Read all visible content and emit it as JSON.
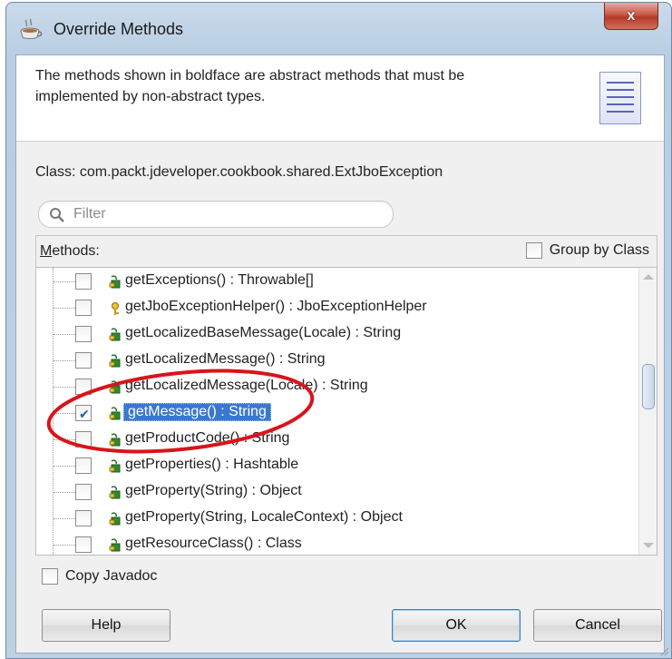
{
  "window": {
    "title": "Override Methods",
    "close_label": "x"
  },
  "header": {
    "description": "The methods shown in boldface are abstract methods that must be implemented by non-abstract types.",
    "icon": "document-icon"
  },
  "class_line": "Class: com.packt.jdeveloper.cookbook.shared.ExtJboException",
  "filter": {
    "placeholder": "Filter",
    "value": "",
    "icon": "search-icon"
  },
  "methods_label": "Methods:",
  "group_by_class": {
    "label": "Group by Class",
    "checked": false
  },
  "methods": [
    {
      "label": "getExceptions() : Throwable[]",
      "checked": false,
      "icon": "method-icon"
    },
    {
      "label": "getJboExceptionHelper() : JboExceptionHelper",
      "checked": false,
      "icon": "key-icon"
    },
    {
      "label": "getLocalizedBaseMessage(Locale) : String",
      "checked": false,
      "icon": "method-icon"
    },
    {
      "label": "getLocalizedMessage() : String",
      "checked": false,
      "icon": "method-icon"
    },
    {
      "label": "getLocalizedMessage(Locale) : String",
      "checked": false,
      "icon": "method-icon"
    },
    {
      "label": "getMessage() : String",
      "checked": true,
      "selected": true,
      "icon": "method-icon"
    },
    {
      "label": "getProductCode() : String",
      "checked": false,
      "icon": "method-icon"
    },
    {
      "label": "getProperties() : Hashtable",
      "checked": false,
      "icon": "method-icon"
    },
    {
      "label": "getProperty(String) : Object",
      "checked": false,
      "icon": "method-icon"
    },
    {
      "label": "getProperty(String, LocaleContext) : Object",
      "checked": false,
      "icon": "method-icon"
    },
    {
      "label": "getResourceClass() : Class",
      "checked": false,
      "icon": "method-icon"
    }
  ],
  "copy_javadoc": {
    "label": "Copy Javadoc",
    "checked": false
  },
  "buttons": {
    "help": "Help",
    "ok": "OK",
    "cancel": "Cancel"
  },
  "colors": {
    "selection": "#3a78d0",
    "annotation": "#d9141b",
    "method_icon": "#2e8b2e"
  }
}
